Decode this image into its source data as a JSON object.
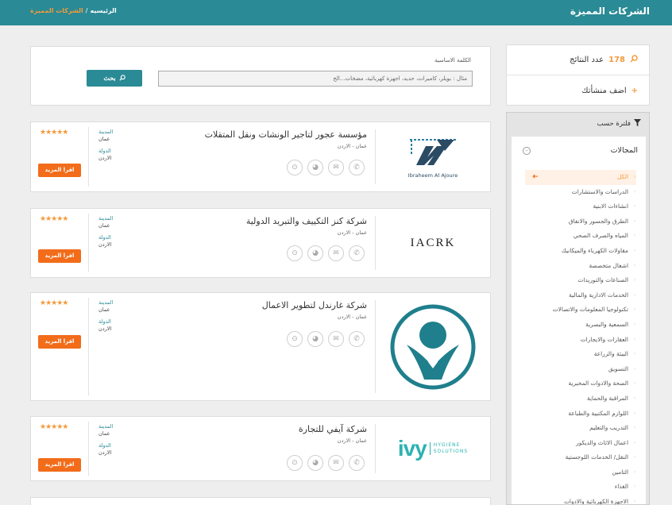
{
  "header": {
    "title": "الشركات المميزة",
    "breadcrumb_home": "الرئيسيه",
    "breadcrumb_sep": "/",
    "breadcrumb_current": "الشركات المميزة"
  },
  "search": {
    "keyword_label": "الكلمة الاساسية",
    "placeholder": "مثال : بويلر، كاميرات، حديد، اجهزة كهربائية، مضخات...الخ",
    "button_label": "بحث"
  },
  "sidebar": {
    "results_count": "178",
    "results_label": "عدد النتائج",
    "add_label": "اضف منشأتك",
    "filter_label": "فلترة حسب",
    "panel_title": "المجالات",
    "categories": [
      "الكل",
      "الدراسات والاستشارات",
      "انشاءات الابنية",
      "الطرق والجسور والانفاق",
      "المياه والصرف الصحي",
      "مقاولات الكهرباء والميكانيك",
      "اشغال متخصصة",
      "الصناعات والتوريدات",
      "الخدمات الادارية والمالية",
      "تكنولوجيا المعلومات والاتصالات",
      "السمعية والبصرية",
      "العقارات والايجارات",
      "البيئة والزراعة",
      "التسويق",
      "الصحة والادوات المخبرية",
      "المراقبة والحماية",
      "اللوازم المكتبية والطباعة",
      "التدريب والتعليم",
      "اعمال الاثاث والديكور",
      "النقل/ الخدمات اللوجستية",
      "التامين",
      "الغذاء",
      "الاجهزة الكهربائية والادوات"
    ]
  },
  "companies": [
    {
      "name": "مؤسسة عجور لتاجير الونشات ونقل المتقلات",
      "location": "عمان - الاردن",
      "city_label": "المدينة",
      "city": "عمان",
      "country_label": "الدولة",
      "country": "الاردن",
      "stars": "★★★★★",
      "more_label": "اقرا المزيد",
      "logo_text": "Ibraheem Al Ajoure"
    },
    {
      "name": "شركة كنز التكييف والتبريد الدولية",
      "location": "عمان - الاردن",
      "city_label": "المدينة",
      "city": "عمان",
      "country_label": "الدولة",
      "country": "الاردن",
      "stars": "★★★★★",
      "more_label": "اقرا المزيد",
      "logo_text": "IACRK"
    },
    {
      "name": "شركة غارندل لتطوير الاعمال",
      "location": "عمان - الاردن",
      "city_label": "المدينة",
      "city": "عمان",
      "country_label": "الدولة",
      "country": "الاردن",
      "stars": "★★★★★",
      "more_label": "اقرا المزيد",
      "logo_text": ""
    },
    {
      "name": "شركة آيفي للتجارة",
      "location": "عمان - الاردن",
      "city_label": "المدينة",
      "city": "عمان",
      "country_label": "الدولة",
      "country": "الاردن",
      "stars": "★★★★★",
      "more_label": "اقرا المزيد",
      "logo_text": "ivy",
      "logo_sub1": "HYGIENE",
      "logo_sub2": "SOLUTIONS"
    }
  ],
  "colors": {
    "header": "#2a8a95",
    "accent_orange": "#f49a3b",
    "button_orange": "#f26c1a"
  }
}
